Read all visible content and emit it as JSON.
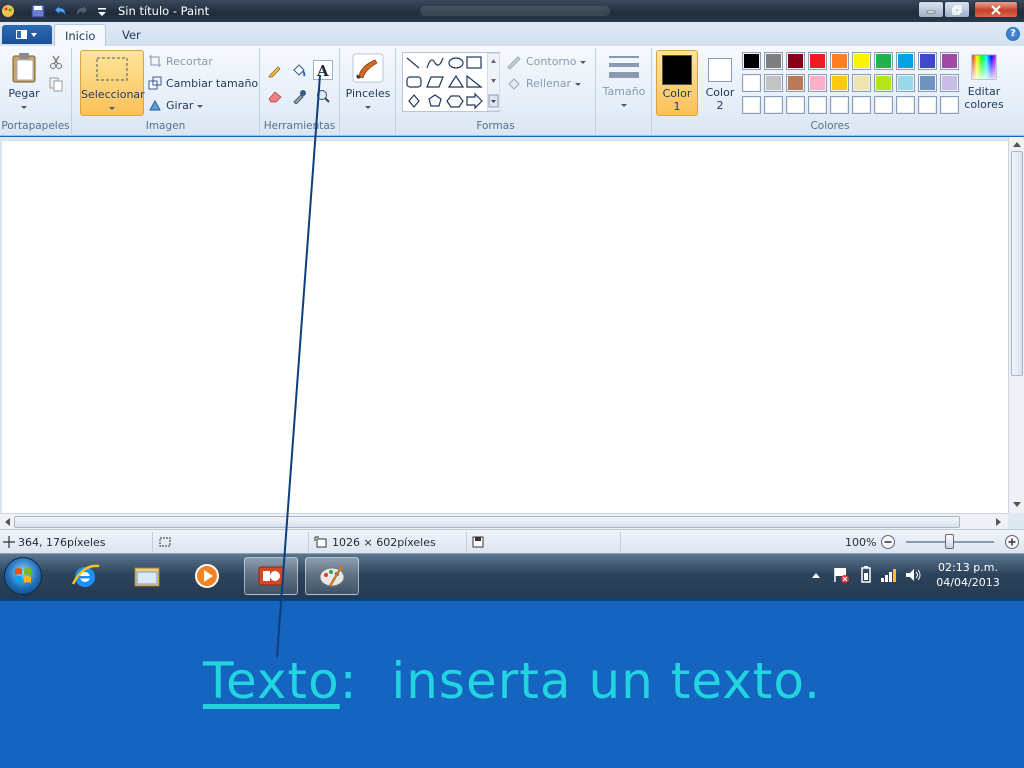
{
  "window": {
    "title": "Sin título - Paint"
  },
  "tabs": [
    {
      "label": "Inicio",
      "active": true
    },
    {
      "label": "Ver",
      "active": false
    }
  ],
  "ribbon": {
    "portapapeles": {
      "group_label": "Portapapeles",
      "paste_label": "Pegar"
    },
    "imagen": {
      "group_label": "Imagen",
      "select_label": "Seleccionar",
      "crop_label": "Recortar",
      "resize_label": "Cambiar tamaño",
      "rotate_label": "Girar"
    },
    "herramientas": {
      "group_label": "Herramientas"
    },
    "pinceles": {
      "label": "Pinceles"
    },
    "formas": {
      "group_label": "Formas",
      "outline_label": "Contorno",
      "fill_label": "Rellenar"
    },
    "tamano": {
      "label": "Tamaño"
    },
    "colores": {
      "group_label": "Colores",
      "color1_label": "Color",
      "color1_num": "1",
      "color2_label": "Color",
      "color2_num": "2",
      "edit_label": "Editar",
      "edit_label2": "colores",
      "color1_value": "#000000",
      "color2_value": "#ffffff",
      "palette_row1": [
        "#000000",
        "#7f7f7f",
        "#880015",
        "#ed1c24",
        "#ff7f27",
        "#fff200",
        "#22b14c",
        "#00a2e8",
        "#3f48cc",
        "#a349a4"
      ],
      "palette_row2": [
        "#ffffff",
        "#c3c3c3",
        "#b97a57",
        "#ffaec9",
        "#ffc90e",
        "#efe4b0",
        "#b5e61d",
        "#99d9ea",
        "#7092be",
        "#c8bfe7"
      ],
      "palette_row3": [
        "#ffffff",
        "#ffffff",
        "#ffffff",
        "#ffffff",
        "#ffffff",
        "#ffffff",
        "#ffffff",
        "#ffffff",
        "#ffffff",
        "#ffffff"
      ]
    }
  },
  "statusbar": {
    "cursor_pos": "364, 176píxeles",
    "canvas_size": "1026 × 602píxeles",
    "zoom": "100%"
  },
  "taskbar": {
    "time": "02:13 p.m.",
    "date": "04/04/2013"
  },
  "caption": {
    "term": "Texto",
    "rest": ":  inserta un texto."
  },
  "colors": {
    "caption_text": "#22d3e0",
    "slide_bg": "#1565c0",
    "pointer_line": "#0d3f7a"
  }
}
